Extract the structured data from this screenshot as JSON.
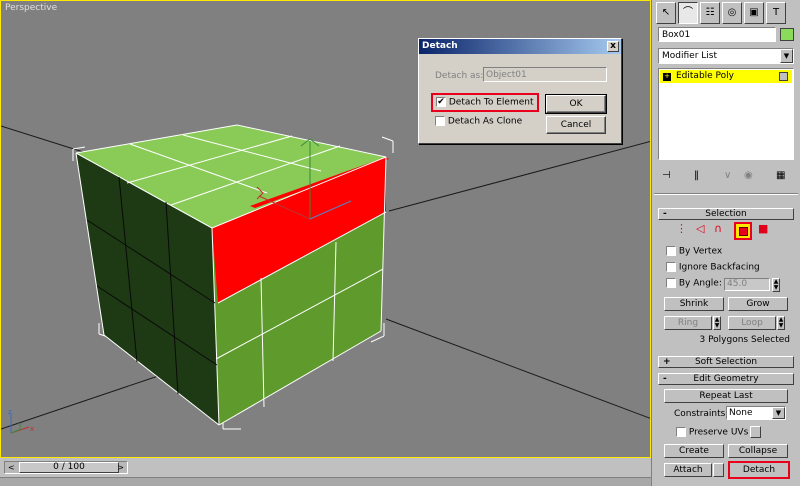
{
  "viewport": {
    "label": "Perspective"
  },
  "dialog": {
    "title": "Detach",
    "close_glyph": "x",
    "detach_as_label": "Detach as:",
    "detach_as_value": "Object01",
    "detach_to_element_label": "Detach To Element",
    "detach_to_element_checked": true,
    "detach_as_clone_label": "Detach As Clone",
    "detach_as_clone_checked": false,
    "ok_label": "OK",
    "cancel_label": "Cancel"
  },
  "timeline": {
    "frame_label": "0 / 100",
    "prev_glyph": "<",
    "next_glyph": ">"
  },
  "panel": {
    "tabs": [
      {
        "icon": "create-icon",
        "glyph": "↖"
      },
      {
        "icon": "modify-icon",
        "glyph": "⌒"
      },
      {
        "icon": "hierarchy-icon",
        "glyph": "☷"
      },
      {
        "icon": "motion-icon",
        "glyph": "◎"
      },
      {
        "icon": "display-icon",
        "glyph": "▣"
      },
      {
        "icon": "utilities-icon",
        "glyph": "T"
      }
    ],
    "object_name": "Box01",
    "object_color": "#8adb5c",
    "modifier_list": "Modifier List",
    "stack_item": "Editable Poly",
    "selection": {
      "title": "Selection",
      "by_vertex": "By Vertex",
      "ignore_backfacing": "Ignore Backfacing",
      "by_angle": "By Angle:",
      "angle_value": "45.0",
      "shrink": "Shrink",
      "grow": "Grow",
      "ring": "Ring",
      "loop": "Loop",
      "status": "3 Polygons Selected"
    },
    "soft_selection": {
      "title": "Soft Selection"
    },
    "edit_geometry": {
      "title": "Edit Geometry",
      "repeat_last": "Repeat Last",
      "constraints_label": "Constraints:",
      "constraints_value": "None",
      "preserve_uvs": "Preserve UVs",
      "create": "Create",
      "collapse": "Collapse",
      "attach": "Attach",
      "detach": "Detach"
    }
  }
}
